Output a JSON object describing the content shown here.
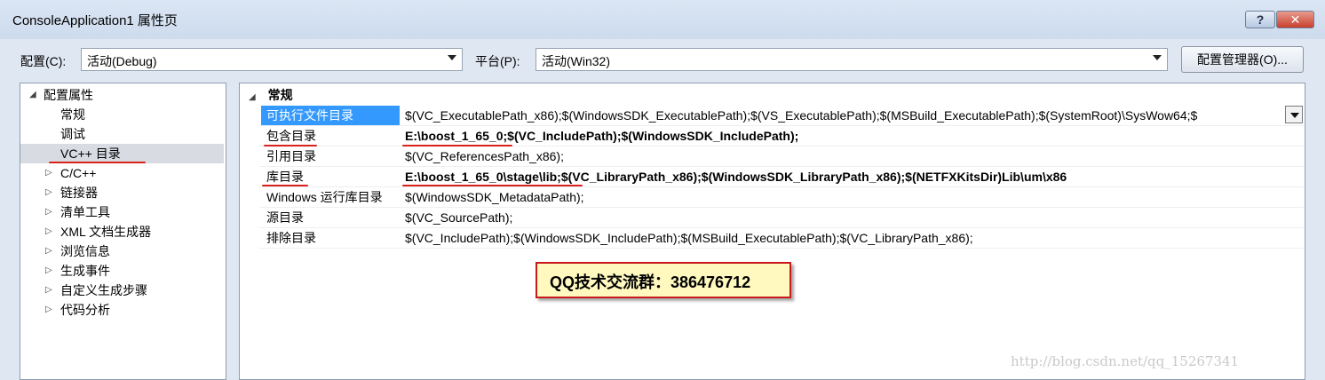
{
  "window": {
    "title": "ConsoleApplication1 属性页",
    "help_glyph": "?",
    "close_glyph": "✕"
  },
  "toolbar": {
    "config_label": "配置(C):",
    "config_value": "活动(Debug)",
    "platform_label": "平台(P):",
    "platform_value": "活动(Win32)",
    "manager_button": "配置管理器(O)..."
  },
  "tree": {
    "root": "配置属性",
    "items": [
      {
        "label": "常规",
        "expandable": false
      },
      {
        "label": "调试",
        "expandable": false
      },
      {
        "label": "VC++ 目录",
        "expandable": false,
        "selected": true
      },
      {
        "label": "C/C++",
        "expandable": true
      },
      {
        "label": "链接器",
        "expandable": true
      },
      {
        "label": "清单工具",
        "expandable": true
      },
      {
        "label": "XML 文档生成器",
        "expandable": true
      },
      {
        "label": "浏览信息",
        "expandable": true
      },
      {
        "label": "生成事件",
        "expandable": true
      },
      {
        "label": "自定义生成步骤",
        "expandable": true
      },
      {
        "label": "代码分析",
        "expandable": true
      }
    ]
  },
  "grid": {
    "section": "常规",
    "rows": [
      {
        "name": "可执行文件目录",
        "value": "$(VC_ExecutablePath_x86);$(WindowsSDK_ExecutablePath);$(VS_ExecutablePath);$(MSBuild_ExecutablePath);$(SystemRoot)\\SysWow64;$",
        "selected": true,
        "bold": false
      },
      {
        "name": "包含目录",
        "value": "E:\\boost_1_65_0;$(VC_IncludePath);$(WindowsSDK_IncludePath);",
        "selected": false,
        "bold": true
      },
      {
        "name": "引用目录",
        "value": "$(VC_ReferencesPath_x86);",
        "selected": false,
        "bold": false
      },
      {
        "name": "库目录",
        "value": "E:\\boost_1_65_0\\stage\\lib;$(VC_LibraryPath_x86);$(WindowsSDK_LibraryPath_x86);$(NETFXKitsDir)Lib\\um\\x86",
        "selected": false,
        "bold": true
      },
      {
        "name": "Windows 运行库目录",
        "value": "$(WindowsSDK_MetadataPath);",
        "selected": false,
        "bold": false
      },
      {
        "name": "源目录",
        "value": "$(VC_SourcePath);",
        "selected": false,
        "bold": false
      },
      {
        "name": "排除目录",
        "value": "$(VC_IncludePath);$(WindowsSDK_IncludePath);$(MSBuild_ExecutablePath);$(VC_LibraryPath_x86);",
        "selected": false,
        "bold": false
      }
    ]
  },
  "annotation": {
    "note": "QQ技术交流群：386476712"
  },
  "watermark": "http://blog.csdn.net/qq_15267341",
  "colors": {
    "selection_blue": "#3399ff",
    "underline_red": "#d9221a",
    "note_border": "#c8191b",
    "note_fill": "#fff9c0"
  }
}
